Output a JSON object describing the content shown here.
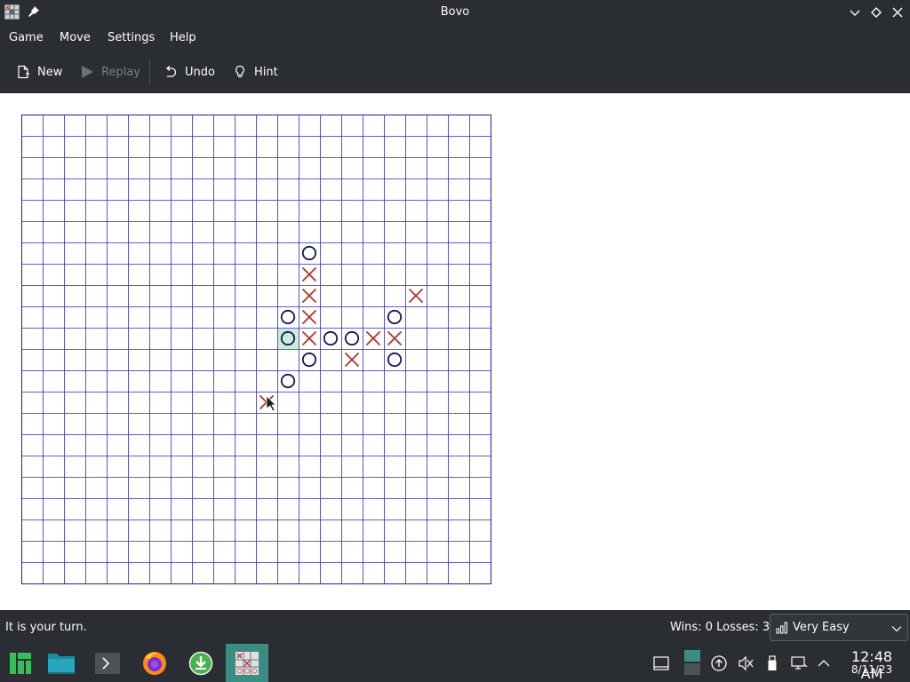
{
  "window": {
    "title": "Bovo"
  },
  "menu": {
    "items": [
      "Game",
      "Move",
      "Settings",
      "Help"
    ]
  },
  "toolbar": {
    "new_label": "New",
    "replay_label": "Replay",
    "undo_label": "Undo",
    "hint_label": "Hint"
  },
  "board": {
    "columns": 22,
    "rows": 22,
    "line_color": "#2b2bbf",
    "x_color": "#b3312a",
    "o_color": "#14145c",
    "highlight_color": "#c8ecd4",
    "cursor_cell": {
      "col": 11,
      "row": 13
    },
    "moves": [
      {
        "mark": "O",
        "col": 13,
        "row": 6
      },
      {
        "mark": "X",
        "col": 13,
        "row": 7
      },
      {
        "mark": "X",
        "col": 13,
        "row": 8
      },
      {
        "mark": "X",
        "col": 18,
        "row": 8
      },
      {
        "mark": "O",
        "col": 12,
        "row": 9
      },
      {
        "mark": "X",
        "col": 13,
        "row": 9
      },
      {
        "mark": "O",
        "col": 17,
        "row": 9
      },
      {
        "mark": "O",
        "col": 12,
        "row": 10,
        "last": true
      },
      {
        "mark": "X",
        "col": 13,
        "row": 10
      },
      {
        "mark": "O",
        "col": 14,
        "row": 10
      },
      {
        "mark": "O",
        "col": 15,
        "row": 10
      },
      {
        "mark": "X",
        "col": 16,
        "row": 10
      },
      {
        "mark": "X",
        "col": 17,
        "row": 10
      },
      {
        "mark": "O",
        "col": 13,
        "row": 11
      },
      {
        "mark": "X",
        "col": 15,
        "row": 11
      },
      {
        "mark": "O",
        "col": 17,
        "row": 11
      },
      {
        "mark": "O",
        "col": 12,
        "row": 12
      },
      {
        "mark": "X",
        "col": 11,
        "row": 13
      }
    ]
  },
  "status": {
    "message": "It is your turn.",
    "score": "Wins: 0  Losses: 3",
    "difficulty": "Very Easy"
  },
  "taskbar": {
    "apps": [
      "manjaro-menu-icon",
      "file-manager-icon",
      "terminal-icon",
      "firefox-icon",
      "download-manager-icon",
      "bovo-icon"
    ],
    "clock_time": "12:48 AM",
    "clock_date": "8/11/23"
  }
}
